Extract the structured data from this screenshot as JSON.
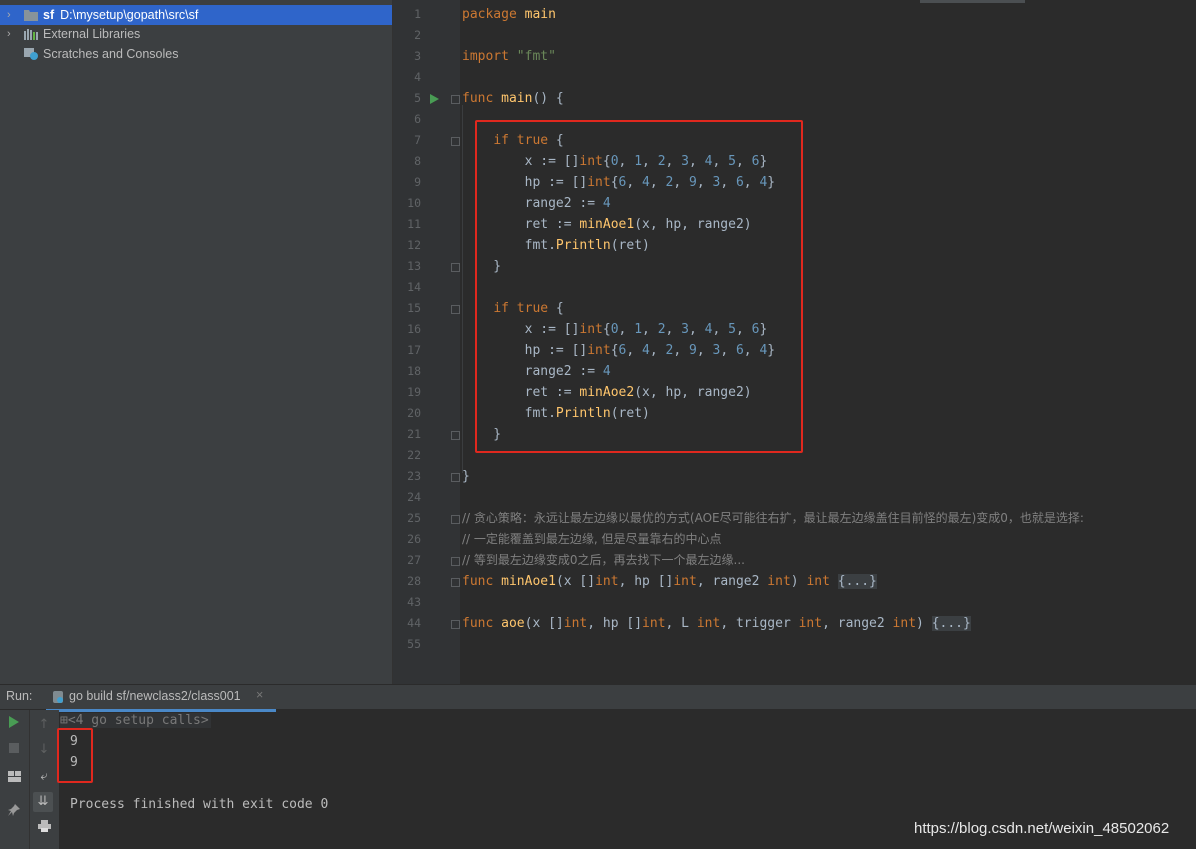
{
  "project_tree": {
    "items": [
      {
        "arrow": "›",
        "name": "sf",
        "path": "D:\\mysetup\\gopath\\src\\sf",
        "selected": true
      },
      {
        "arrow": "›",
        "name": "External Libraries"
      },
      {
        "arrow": "",
        "name": "Scratches and Consoles"
      }
    ]
  },
  "editor": {
    "line_numbers": [
      "1",
      "2",
      "3",
      "4",
      "5",
      "6",
      "7",
      "8",
      "9",
      "10",
      "11",
      "12",
      "13",
      "14",
      "15",
      "16",
      "17",
      "18",
      "19",
      "20",
      "21",
      "22",
      "23",
      "24",
      "25",
      "26",
      "27",
      "28",
      "43",
      "44",
      "55"
    ],
    "comments": [
      "// 贪心策略：永远让最左边缘以最优的方式(AOE尽可能往右扩，最让最左边缘盖住目前怪的最左)变成0，也就是选择:",
      "// 一定能覆盖到最左边缘, 但是尽量靠右的中心点",
      "// 等到最左边缘变成0之后，再去找下一个最左边缘..."
    ]
  },
  "run_panel": {
    "label": "Run:",
    "tab_label": "go build sf/newclass2/class001",
    "tab_close": "×",
    "fold_text": "<4 go setup calls>",
    "outputs": [
      "9",
      "9"
    ],
    "finish_text": "Process finished with exit code 0"
  },
  "watermark": "https://blog.csdn.net/weixin_48502062"
}
